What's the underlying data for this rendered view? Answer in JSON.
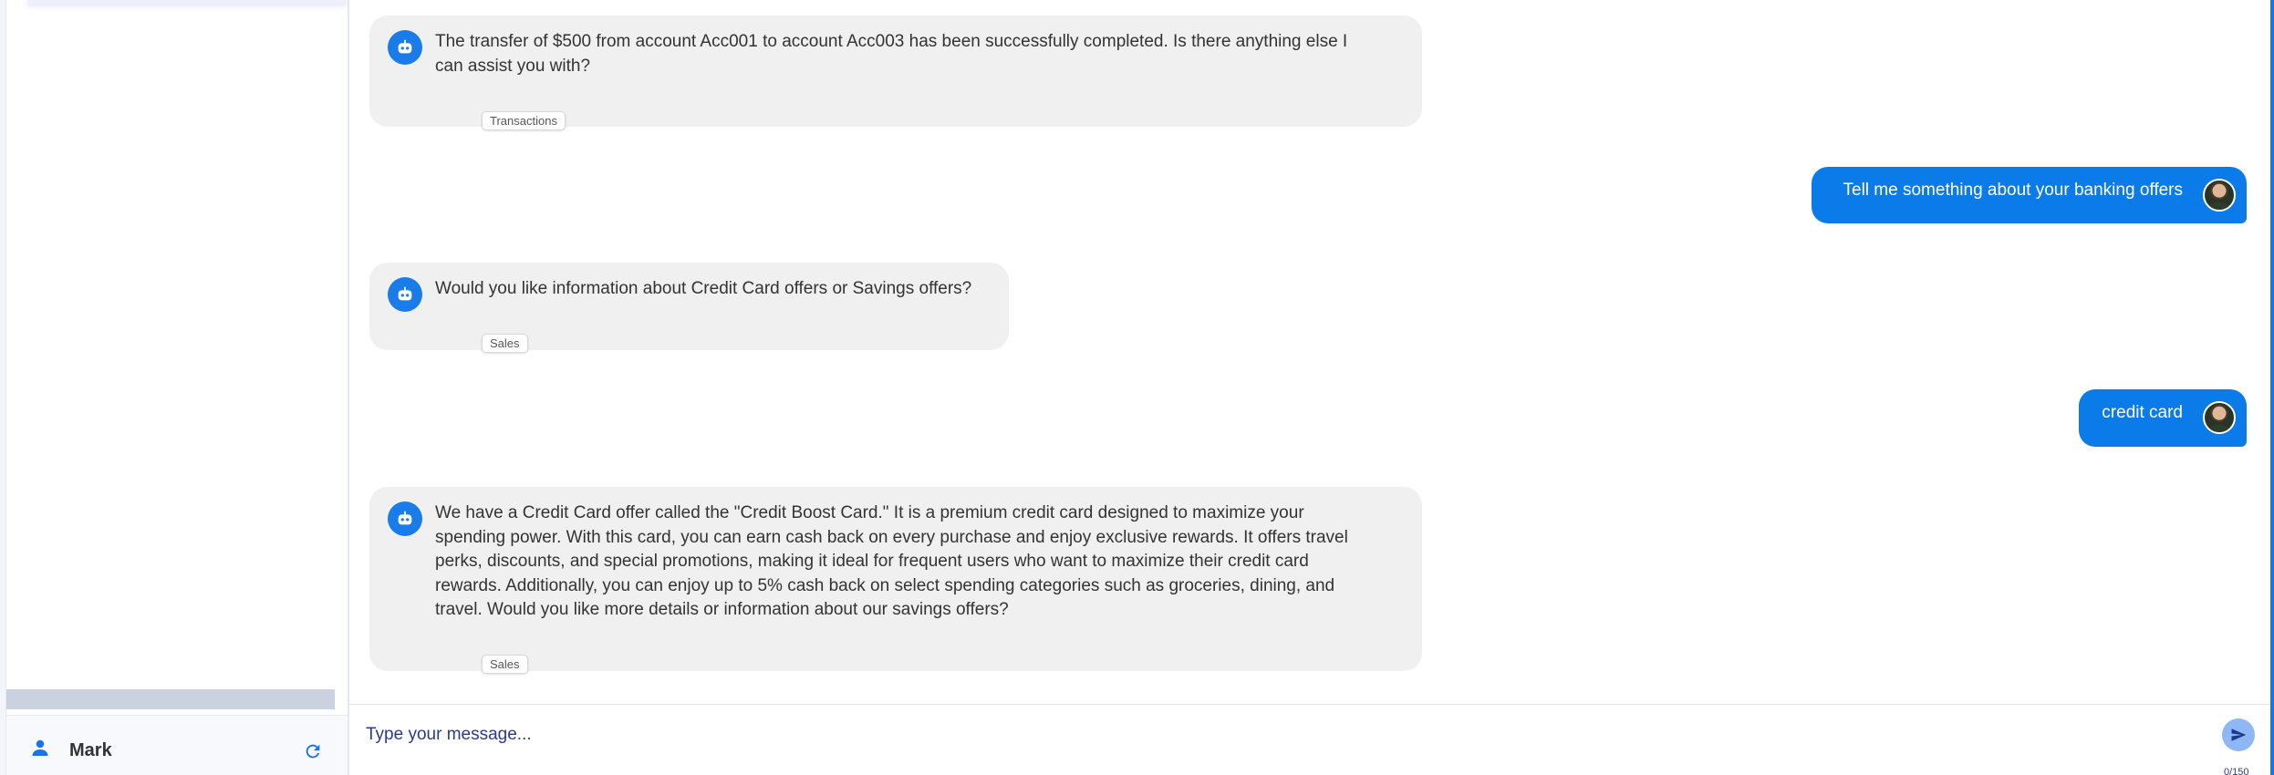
{
  "sidebar": {
    "user": {
      "name": "Mark",
      "icon": "person-icon"
    },
    "refresh_icon": "refresh-icon"
  },
  "messages": [
    {
      "role": "bot",
      "text_lines": [
        "The transfer of $500 from account Acc001 to account Acc003 has been successfully completed. Is there anything else I",
        "can assist you with?"
      ],
      "tag": "Transactions"
    },
    {
      "role": "user",
      "text": "Tell me something about your banking offers"
    },
    {
      "role": "bot",
      "text_lines": [
        "Would you like information about Credit Card offers or Savings offers?"
      ],
      "tag": "Sales"
    },
    {
      "role": "user",
      "text": "credit card"
    },
    {
      "role": "bot",
      "text_lines": [
        "We have a Credit Card offer called the \"Credit Boost Card.\" It is a premium credit card designed to maximize your",
        "spending power. With this card, you can earn cash back on every purchase and enjoy exclusive rewards. It offers travel",
        "perks, discounts, and special promotions, making it ideal for frequent users who want to maximize their credit card",
        "rewards. Additionally, you can enjoy up to 5% cash back on select spending categories such as groceries, dining, and",
        "travel. Would you like more details or information about our savings offers?"
      ],
      "tag": "Sales"
    }
  ],
  "composer": {
    "placeholder": "Type your message...",
    "counter": "0/150",
    "send_icon": "send-icon"
  },
  "colors": {
    "accent": "#0b7bea",
    "bot_bubble": "#f0f0f0",
    "placeholder_text": "#2d3a8c"
  }
}
